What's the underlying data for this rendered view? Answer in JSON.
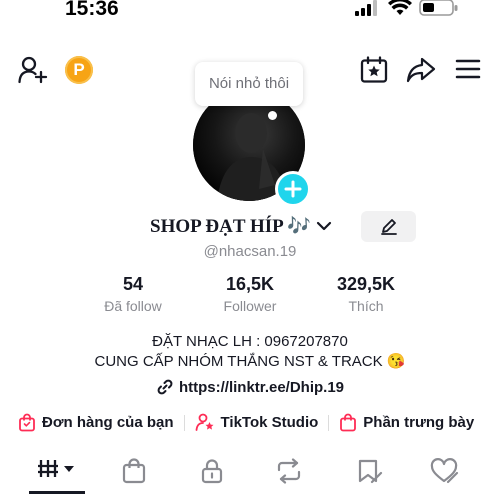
{
  "status_bar": {
    "time": "15:36"
  },
  "profile": {
    "tooltip": "Nói nhỏ thôi",
    "display_name": "SHOP ĐẠT HÍP 🎶",
    "username": "@nhacsan.19",
    "coin_label": "P"
  },
  "stats": [
    {
      "value": "54",
      "label": "Đã follow"
    },
    {
      "value": "16,5K",
      "label": "Follower"
    },
    {
      "value": "329,5K",
      "label": "Thích"
    }
  ],
  "bio": {
    "line1": "ĐẶT NHẠC LH : 0967207870",
    "line2": "CUNG CẤP NHÓM THẮNG NST & TRACK 😘",
    "link": "https://linktr.ee/Dhip.19"
  },
  "quick_links": [
    {
      "label": "Đơn hàng của bạn",
      "icon": "shopping-bag-icon"
    },
    {
      "label": "TikTok Studio",
      "icon": "person-star-icon"
    },
    {
      "label": "Phần trưng bày",
      "icon": "showcase-bag-icon"
    }
  ],
  "tabs": [
    {
      "name": "videos-grid-icon",
      "active": true
    },
    {
      "name": "shop-bag-icon",
      "active": false
    },
    {
      "name": "lock-icon",
      "active": false
    },
    {
      "name": "repost-icon",
      "active": false
    },
    {
      "name": "favorites-icon",
      "active": false
    },
    {
      "name": "liked-icon",
      "active": false
    }
  ],
  "colors": {
    "accent_teal": "#20d5ec",
    "accent_pink": "#fe2c55",
    "coin_orange": "#f7a415",
    "text": "#161823",
    "muted": "#8a8b91"
  }
}
